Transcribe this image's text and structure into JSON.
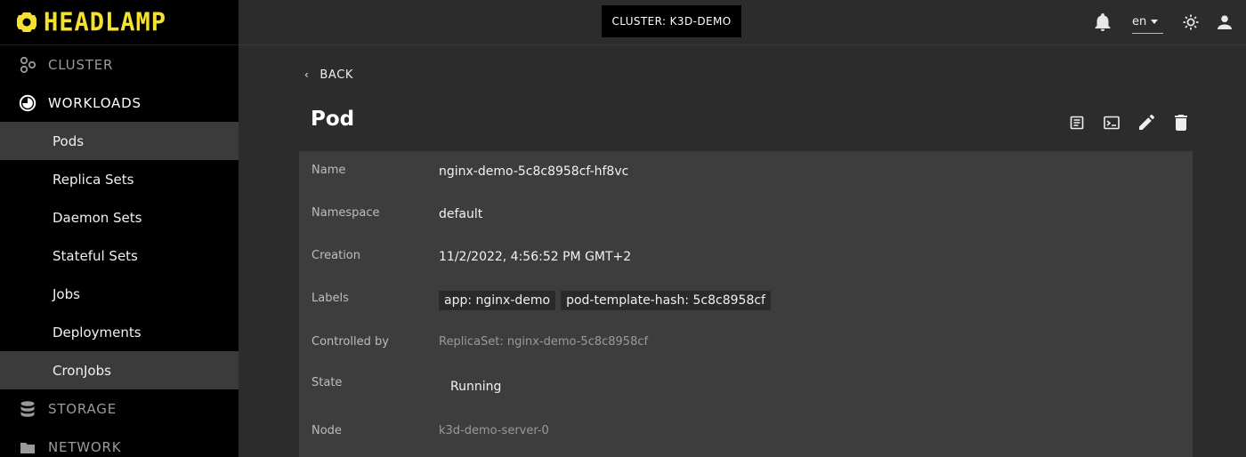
{
  "brand": {
    "name": "HEADLAMP",
    "color": "#f5e12f"
  },
  "sidebar": {
    "sections": [
      {
        "label": "CLUSTER",
        "icon": "cluster-icon"
      },
      {
        "label": "WORKLOADS",
        "icon": "workloads-icon"
      },
      {
        "label": "STORAGE",
        "icon": "storage-icon"
      },
      {
        "label": "NETWORK",
        "icon": "network-icon"
      }
    ],
    "items": [
      {
        "label": "Pods",
        "active": true
      },
      {
        "label": "Replica Sets"
      },
      {
        "label": "Daemon Sets"
      },
      {
        "label": "Stateful Sets"
      },
      {
        "label": "Jobs"
      },
      {
        "label": "Deployments"
      },
      {
        "label": "CronJobs",
        "active": true
      }
    ]
  },
  "topbar": {
    "cluster_label": "CLUSTER: K3D-DEMO",
    "language": "en",
    "icons": [
      "notifications-bell-icon",
      "theme-toggle-icon",
      "user-account-icon"
    ]
  },
  "main": {
    "back_label": "BACK",
    "title": "Pod",
    "actions": [
      "logs-icon",
      "terminal-icon",
      "edit-icon",
      "delete-icon"
    ],
    "details": {
      "name_label": "Name",
      "name_value": "nginx-demo-5c8c8958cf-hf8vc",
      "namespace_label": "Namespace",
      "namespace_value": "default",
      "creation_label": "Creation",
      "creation_value": "11/2/2022, 4:56:52 PM GMT+2",
      "labels_label": "Labels",
      "labels": [
        "app: nginx-demo",
        "pod-template-hash: 5c8c8958cf"
      ],
      "controlled_by_label": "Controlled by",
      "controlled_by_value": "ReplicaSet: nginx-demo-5c8c8958cf",
      "state_label": "State",
      "state_value": "Running",
      "node_label": "Node",
      "node_value": "k3d-demo-server-0"
    }
  }
}
